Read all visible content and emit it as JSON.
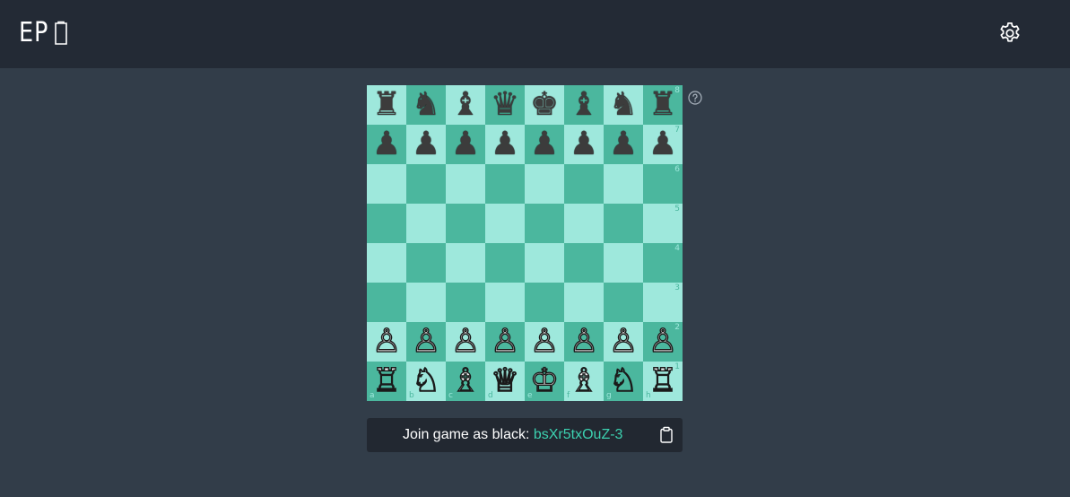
{
  "header": {
    "logo_text": "EP",
    "logo_icon": "tablet-icon",
    "settings_icon": "gear-icon"
  },
  "colors": {
    "page_bg": "#323d49",
    "header_bg": "#232a35",
    "light_square": "#9ee8dc",
    "dark_square": "#4bb79e",
    "accent": "#3cd1b0"
  },
  "board": {
    "ranks": [
      "8",
      "7",
      "6",
      "5",
      "4",
      "3",
      "2",
      "1"
    ],
    "files": [
      "a",
      "b",
      "c",
      "d",
      "e",
      "f",
      "g",
      "h"
    ],
    "pieces": {
      "8": [
        "♜",
        "♞",
        "♝",
        "♛",
        "♚",
        "♝",
        "♞",
        "♜"
      ],
      "7": [
        "♟",
        "♟",
        "♟",
        "♟",
        "♟",
        "♟",
        "♟",
        "♟"
      ],
      "6": [
        "",
        "",
        "",
        "",
        "",
        "",
        "",
        ""
      ],
      "5": [
        "",
        "",
        "",
        "",
        "",
        "",
        "",
        ""
      ],
      "4": [
        "",
        "",
        "",
        "",
        "",
        "",
        "",
        ""
      ],
      "3": [
        "",
        "",
        "",
        "",
        "",
        "",
        "",
        ""
      ],
      "2": [
        "♙",
        "♙",
        "♙",
        "♙",
        "♙",
        "♙",
        "♙",
        "♙"
      ],
      "1": [
        "♖",
        "♘",
        "♗",
        "♕",
        "♔",
        "♗",
        "♘",
        "♖"
      ]
    },
    "help_icon": "question-circle-icon"
  },
  "join": {
    "label": "Join game as black: ",
    "code": "bsXr5txOuZ-3",
    "copy_icon": "clipboard-icon"
  }
}
